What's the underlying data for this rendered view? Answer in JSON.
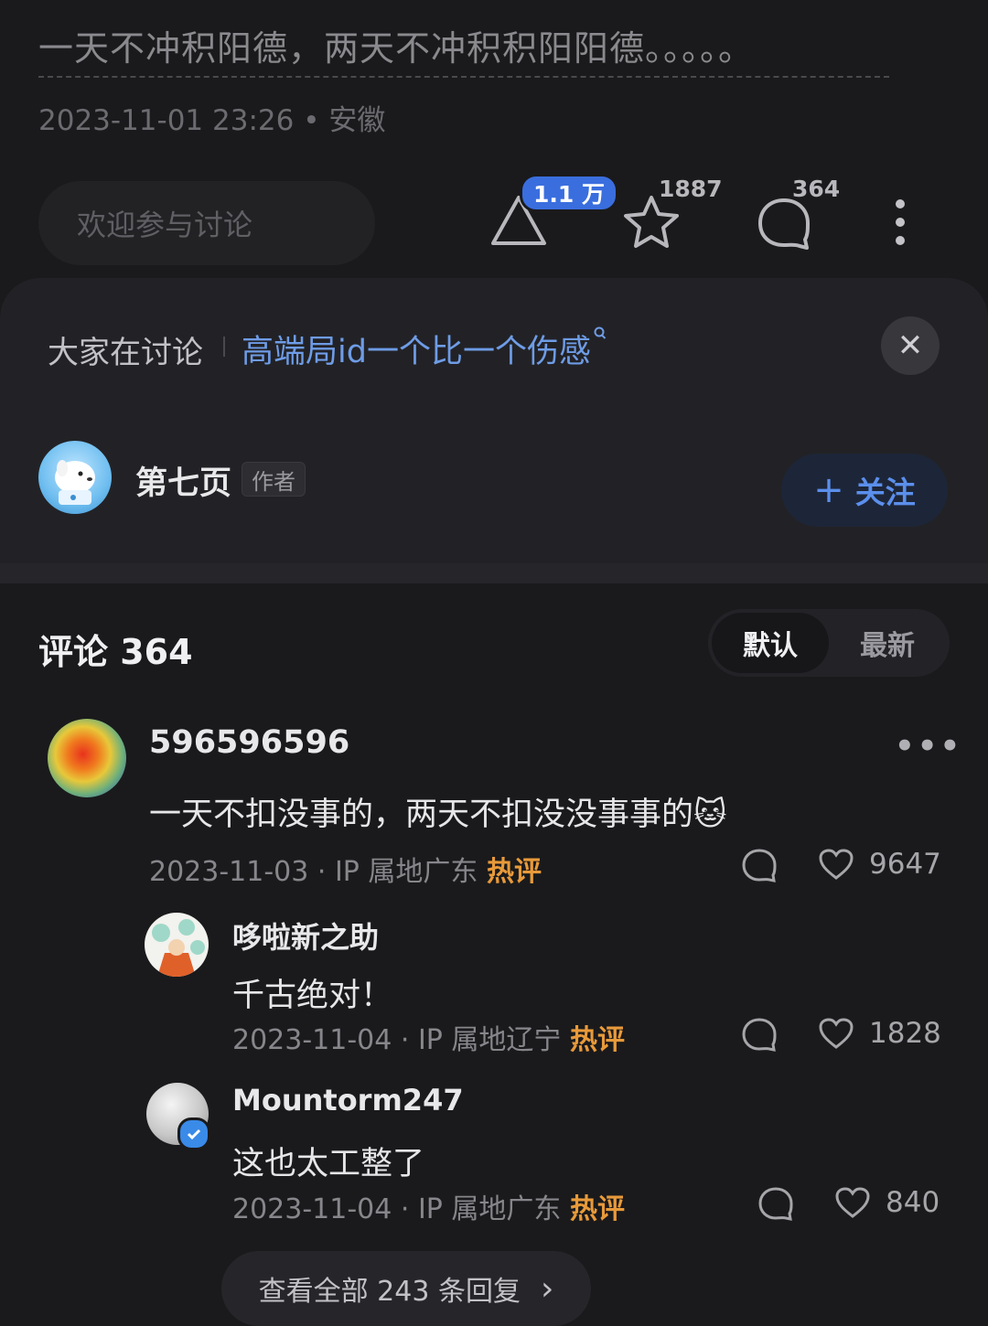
{
  "post": {
    "text": "一天不冲积阳德，两天不冲积积阳阳德。。。。。",
    "meta": "2023-11-01 23:26 • 安徽"
  },
  "action_bar": {
    "input_placeholder": "欢迎参与讨论",
    "like_badge": "1.1 万",
    "favorite_count": "1887",
    "comment_count": "364",
    "icons": [
      "like-triangle-icon",
      "star-icon",
      "comment-bubble-icon",
      "more-vertical-icon"
    ]
  },
  "discuss": {
    "label": "大家在讨论",
    "topic": "高端局id一个比一个伤感",
    "close_symbol": "✕"
  },
  "author": {
    "name": "第七页",
    "tag": "作者",
    "follow_label": "关注",
    "follow_prefix": "+"
  },
  "comments_header": {
    "title": "评论 364",
    "sort_options": [
      "默认",
      "最新"
    ],
    "active_sort": "默认"
  },
  "comments": [
    {
      "user": "596596596",
      "text": "一天不扣没事的，两天不扣没没事事的",
      "emoji": "🐱",
      "meta": "2023-11-03 · IP 属地广东",
      "hot_label": "热评",
      "likes": "9647",
      "more": "•••"
    },
    {
      "user": "哆啦新之助",
      "text": "千古绝对！",
      "meta": "2023-11-04 · IP 属地辽宁",
      "hot_label": "热评",
      "likes": "1828"
    },
    {
      "user": "Mountorm247",
      "text": "这也太工整了",
      "meta": "2023-11-04 · IP 属地广东",
      "hot_label": "热评",
      "likes": "840"
    }
  ],
  "view_all": {
    "label": "查看全部 243 条回复",
    "chevron": "›"
  },
  "colors": {
    "background": "#1a1a1c",
    "accent_blue": "#5b8fec",
    "hot_orange": "#e89a3a",
    "badge_blue": "#3a6ede"
  }
}
